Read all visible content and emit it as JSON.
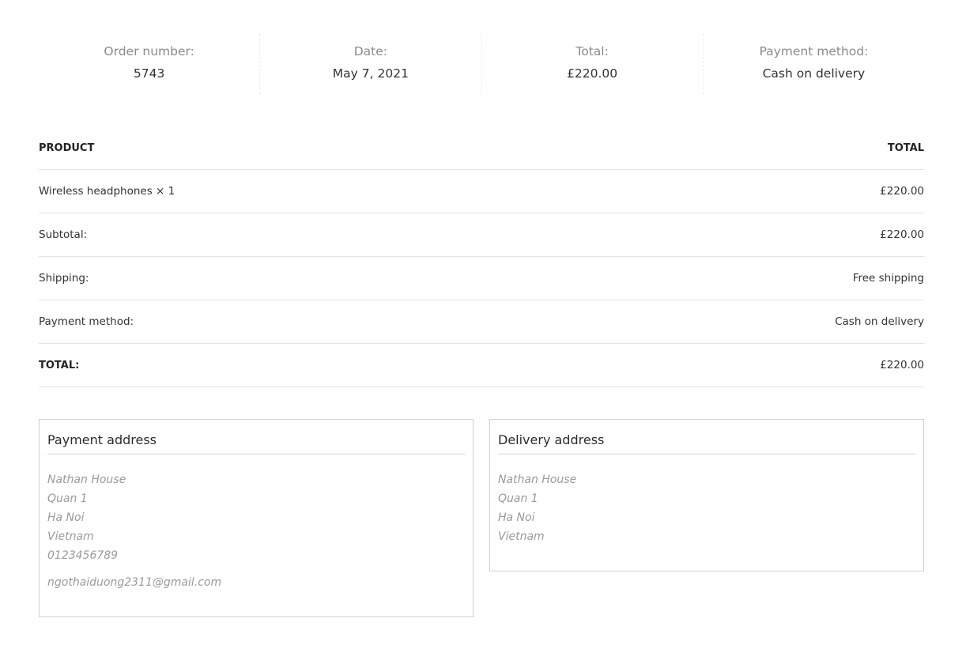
{
  "overview": [
    {
      "label": "Order number:",
      "value": "5743"
    },
    {
      "label": "Date:",
      "value": "May 7, 2021"
    },
    {
      "label": "Total:",
      "value": "£220.00"
    },
    {
      "label": "Payment method:",
      "value": "Cash on delivery"
    }
  ],
  "details": {
    "header": {
      "product": "PRODUCT",
      "total": "TOTAL"
    },
    "rows": [
      {
        "label": "Wireless headphones × 1",
        "value": "£220.00"
      },
      {
        "label": "Subtotal:",
        "value": "£220.00"
      },
      {
        "label": "Shipping:",
        "value": "Free shipping"
      },
      {
        "label": "Payment method:",
        "value": "Cash on delivery"
      },
      {
        "label": "TOTAL:",
        "value": "£220.00"
      }
    ]
  },
  "payment_address": {
    "title": "Payment address",
    "lines": [
      "Nathan House",
      "Quan 1",
      "Ha Noi",
      "Vietnam",
      "0123456789"
    ],
    "email": "ngothaiduong2311@gmail.com"
  },
  "delivery_address": {
    "title": "Delivery address",
    "lines": [
      "Nathan House",
      "Quan 1",
      "Ha Noi",
      "Vietnam"
    ]
  }
}
